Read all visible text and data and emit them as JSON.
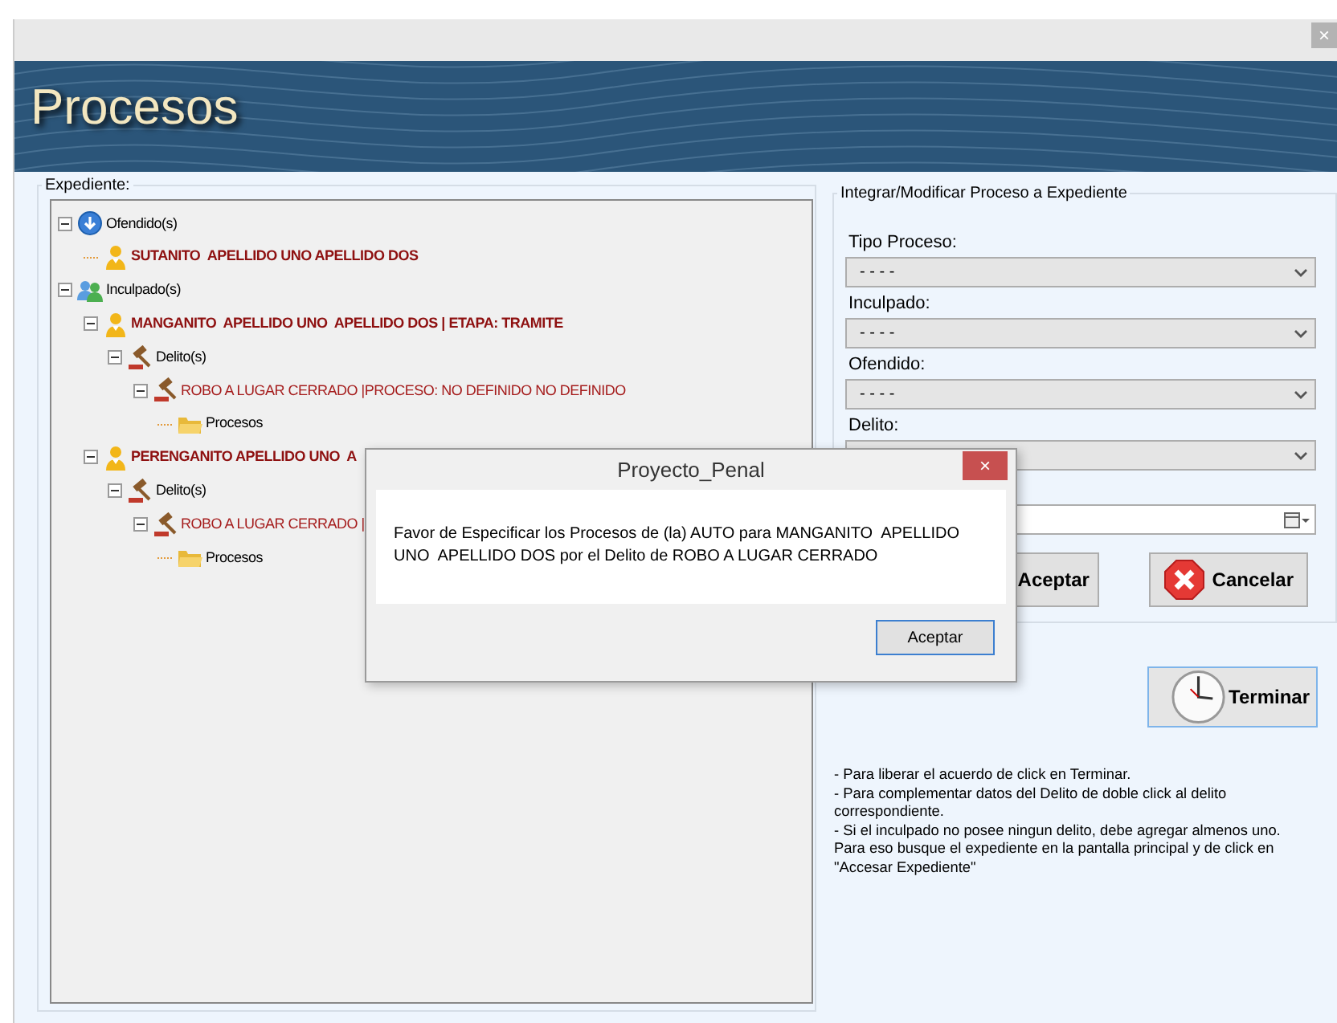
{
  "window": {
    "close_label": "×"
  },
  "banner": {
    "title": "Procesos"
  },
  "expediente": {
    "legend": "Expediente:",
    "tree": [
      {
        "label": "Ofendido(s)",
        "kind": "victims",
        "expanded": true,
        "children": [
          {
            "label": "SUTANITO  APELLIDO UNO APELLIDO DOS",
            "kind": "person"
          }
        ]
      },
      {
        "label": "Inculpado(s)",
        "kind": "accused",
        "expanded": true,
        "children": [
          {
            "label": "MANGANITO  APELLIDO UNO  APELLIDO DOS | ETAPA: TRAMITE",
            "kind": "person",
            "expanded": true,
            "children": [
              {
                "label": "Delito(s)",
                "kind": "crimes",
                "expanded": true,
                "children": [
                  {
                    "label": "ROBO A LUGAR CERRADO |PROCESO: NO DEFINIDO NO DEFINIDO",
                    "kind": "crime",
                    "expanded": true,
                    "children": [
                      {
                        "label": "Procesos",
                        "kind": "folder"
                      }
                    ]
                  }
                ]
              }
            ]
          },
          {
            "label": "PERENGANITO APELLIDO UNO  A",
            "kind": "person",
            "expanded": true,
            "children": [
              {
                "label": "Delito(s)",
                "kind": "crimes",
                "expanded": true,
                "children": [
                  {
                    "label": "ROBO A LUGAR CERRADO |",
                    "kind": "crime",
                    "expanded": true,
                    "children": [
                      {
                        "label": "Procesos",
                        "kind": "folder"
                      }
                    ]
                  }
                ]
              }
            ]
          }
        ]
      }
    ]
  },
  "form": {
    "legend": "Integrar/Modificar Proceso a Expediente",
    "fields": [
      {
        "kind": "select",
        "label": "Tipo Proceso:",
        "value": "- - - -"
      },
      {
        "kind": "select",
        "label": "Inculpado:",
        "value": "- - - -"
      },
      {
        "kind": "select",
        "label": "Ofendido:",
        "value": "- - - -"
      },
      {
        "kind": "select",
        "label": "Delito:"
      },
      {
        "kind": "date"
      }
    ],
    "buttons": [
      {
        "kind": "accept",
        "label": "Aceptar"
      },
      {
        "kind": "cancel",
        "label": "Cancelar"
      }
    ]
  },
  "finish_button": {
    "label": "Terminar"
  },
  "notes": [
    "- Para liberar el acuerdo de click en Terminar.",
    "- Para complementar datos del Delito de doble click al delito",
    "correspondiente.",
    "- Si el inculpado no posee ningun delito, debe agregar almenos uno.",
    "Para eso busque el expediente en la pantalla principal y de click en",
    "\"Accesar Expediente\""
  ],
  "dialog": {
    "title": "Proyecto_Penal",
    "close_label": "×",
    "message": "Favor de Especificar los Procesos de (la) AUTO para MANGANITO  APELLIDO UNO  APELLIDO DOS por el Delito de ROBO A LUGAR CERRADO",
    "button": "Aceptar"
  }
}
